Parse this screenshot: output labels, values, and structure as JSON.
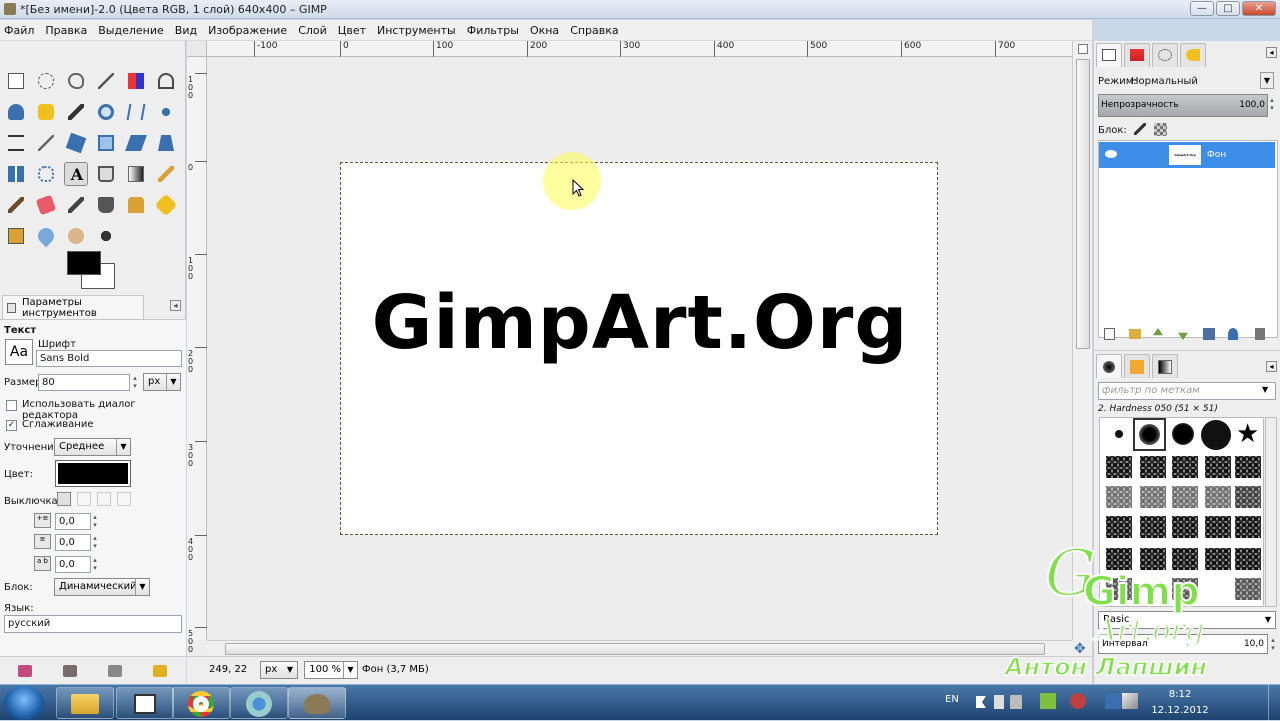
{
  "window": {
    "title": "*[Без имени]-2.0 (Цвета RGB, 1 слой) 640x400 – GIMP",
    "btn_min": "—",
    "btn_max": "□",
    "btn_close": "✕"
  },
  "menu": [
    "Файл",
    "Правка",
    "Выделение",
    "Вид",
    "Изображение",
    "Слой",
    "Цвет",
    "Инструменты",
    "Фильтры",
    "Окна",
    "Справка"
  ],
  "tool_options": {
    "tab_label": "Параметры инструментов",
    "section_title": "Текст",
    "font_label": "Шрифт",
    "font_preview": "Aa",
    "font_value": "Sans Bold",
    "size_label": "Размер:",
    "size_value": "80",
    "size_unit": "px",
    "use_editor_label": "Использовать диалог редактора",
    "antialias_label": "Сглаживание",
    "hinting_label": "Уточнение:",
    "hinting_value": "Среднее",
    "color_label": "Цвет:",
    "justify_label": "Выключка:",
    "indent_value": "0,0",
    "line_spacing_value": "0,0",
    "letter_spacing_value": "0,0",
    "letter_spacing_icon": "a b",
    "box_label": "Блок:",
    "box_value": "Динамический",
    "language_label": "Язык:",
    "language_value": "русский"
  },
  "ruler_h_labels": [
    "-100",
    "0",
    "100",
    "200",
    "300",
    "400",
    "500",
    "600",
    "700"
  ],
  "ruler_v_labels": [
    "100",
    "0",
    "100",
    "200",
    "300",
    "400",
    "500"
  ],
  "canvas": {
    "text": "GimpArt.Org"
  },
  "statusbar": {
    "coords": "249, 22",
    "unit": "px",
    "zoom": "100 %",
    "info": "Фон (3,7 МБ)"
  },
  "layers": {
    "mode_label": "Режим:",
    "mode_value": "Нормальный",
    "opacity_label": "Непрозрачность",
    "opacity_value": "100,0",
    "lock_label": "Блок:",
    "layer_name": "Фон",
    "thumb_text": "GimpArt.Org"
  },
  "brushes": {
    "filter_placeholder": "фильтр по меткам",
    "selected_brush": "2. Hardness 050 (51 × 51)",
    "preset_value": "Basic",
    "spacing_label": "Интервал",
    "spacing_value": "10,0"
  },
  "taskbar": {
    "lang": "EN",
    "time": "8:12",
    "date": "12.12.2012"
  },
  "watermark": {
    "site_line1": "Gimp",
    "site_line2": "Art.org",
    "author": "Антон Лапшин"
  },
  "colors": {
    "selection_blue": "#3d8ee8",
    "watermark_green": "#7fe04a",
    "cursor_highlight": "#ffff50"
  }
}
